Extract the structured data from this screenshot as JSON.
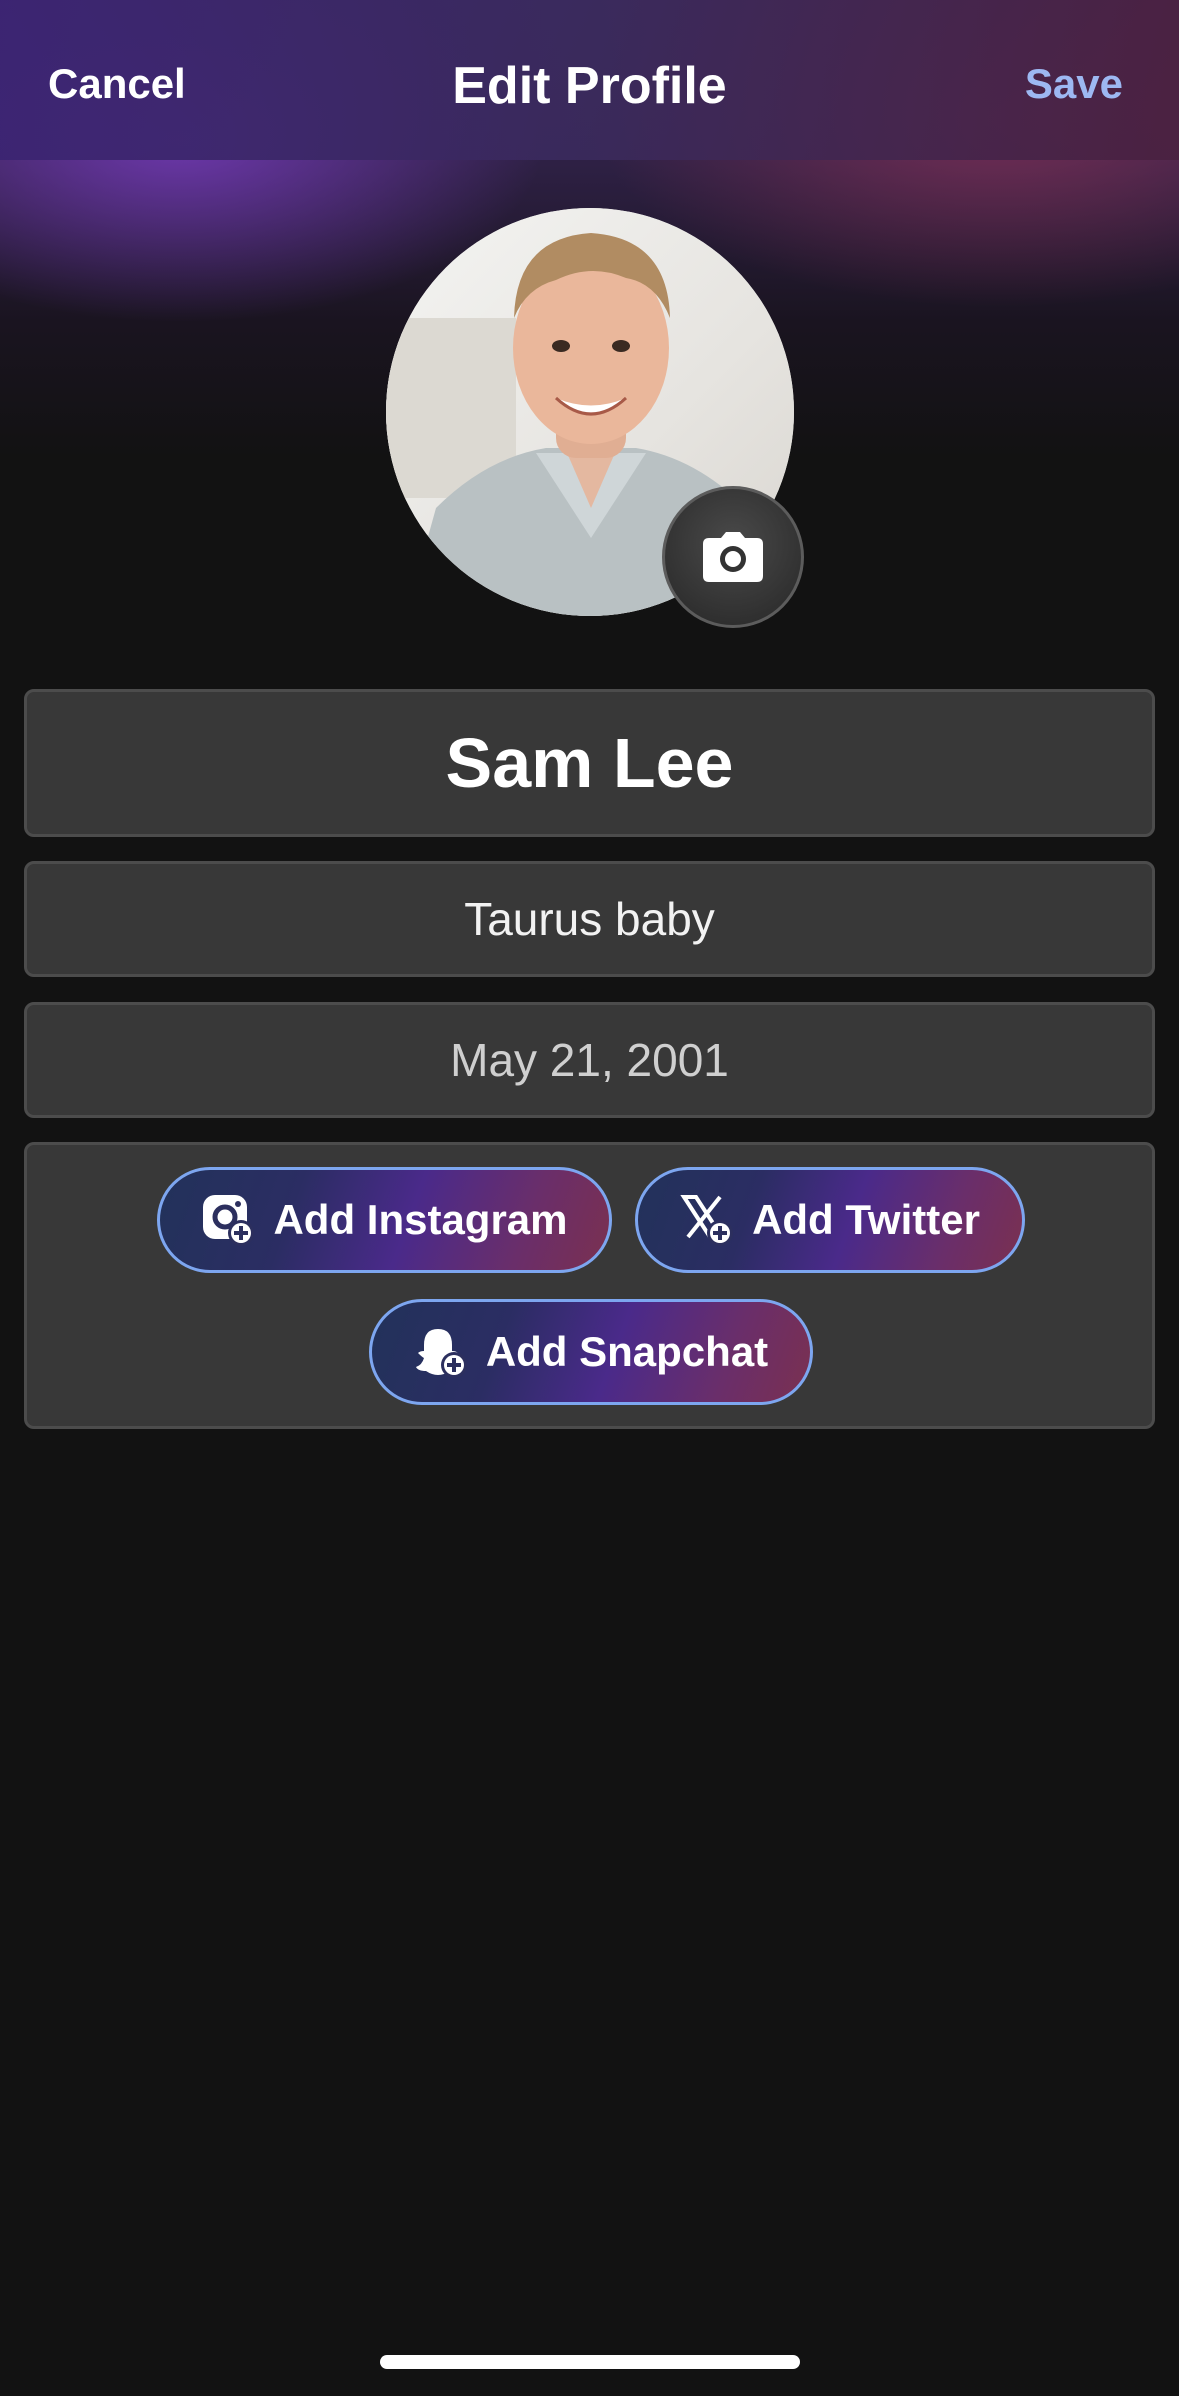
{
  "header": {
    "cancel_label": "Cancel",
    "title": "Edit Profile",
    "save_label": "Save",
    "save_color": "#9db8f2"
  },
  "profile": {
    "avatar_alt": "Profile photo",
    "camera_icon": "camera-icon",
    "name": "Sam Lee",
    "bio": "Taurus baby",
    "birthday": "May 21, 2001"
  },
  "social": {
    "instagram_label": "Add Instagram",
    "instagram_icon": "instagram-add-icon",
    "twitter_label": "Add Twitter",
    "twitter_icon": "x-add-icon",
    "snapchat_label": "Add Snapchat",
    "snapchat_icon": "snapchat-add-icon",
    "button_border_color": "#7da6f0"
  },
  "theme": {
    "background": "#121212",
    "field_background": "#383838"
  }
}
